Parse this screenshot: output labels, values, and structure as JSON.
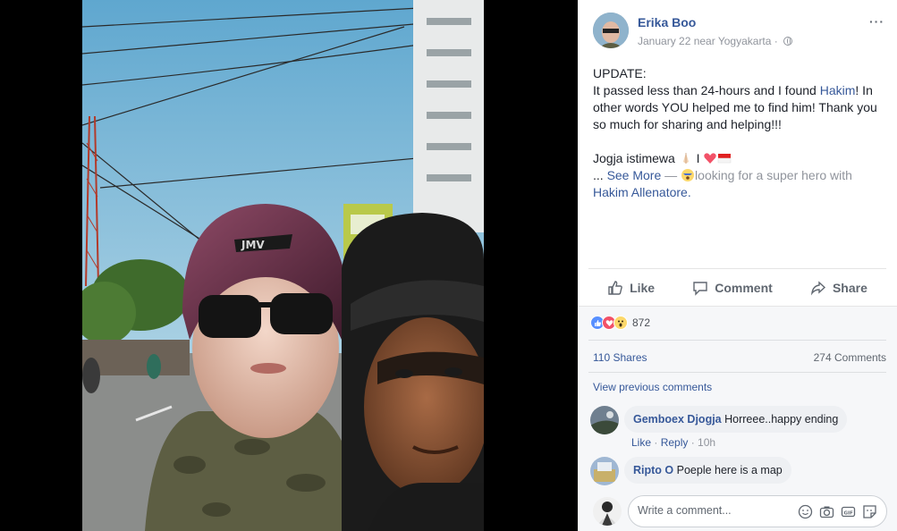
{
  "post": {
    "author": "Erika Boo",
    "meta": "January 22 near Yogyakarta ·",
    "paragraph1_l1": "UPDATE:",
    "paragraph1_l2_a": "It passed less than 24-hours and I found ",
    "paragraph1_l2_link": "Hakim",
    "paragraph1_l2_b": "! In other words YOU helped me to find him! Thank you so much for sharing and helping!!!",
    "paragraph2_a": "Jogja istimewa",
    "paragraph2_b": " I ",
    "see_more_prefix": "... ",
    "see_more": "See More",
    "feeling_sep": " — ",
    "feeling_text": "looking for a super hero with",
    "tagged": "Hakim Allenatore."
  },
  "actions": {
    "like": "Like",
    "comment": "Comment",
    "share": "Share"
  },
  "stats": {
    "reaction_count": "872",
    "shares": "110 Shares",
    "comments": "274 Comments",
    "view_previous": "View previous comments"
  },
  "comments": [
    {
      "name": "Gemboex Djogja",
      "text": "Horreee..happy ending",
      "like": "Like",
      "reply": "Reply",
      "time": "10h"
    },
    {
      "name": "Ripto O",
      "text": "Poeple here is a map"
    }
  ],
  "composer": {
    "placeholder": "Write a comment..."
  },
  "colors": {
    "link": "#365899",
    "like_blue": "#5890ff",
    "love_red": "#f25268",
    "wow_yellow": "#fcd86b"
  },
  "icons": [
    "more-icon",
    "globe-icon",
    "like-icon",
    "comment-icon",
    "share-icon",
    "like-reaction-icon",
    "love-reaction-icon",
    "wow-reaction-icon",
    "emoji-icon",
    "camera-icon",
    "gif-icon",
    "sticker-icon"
  ]
}
